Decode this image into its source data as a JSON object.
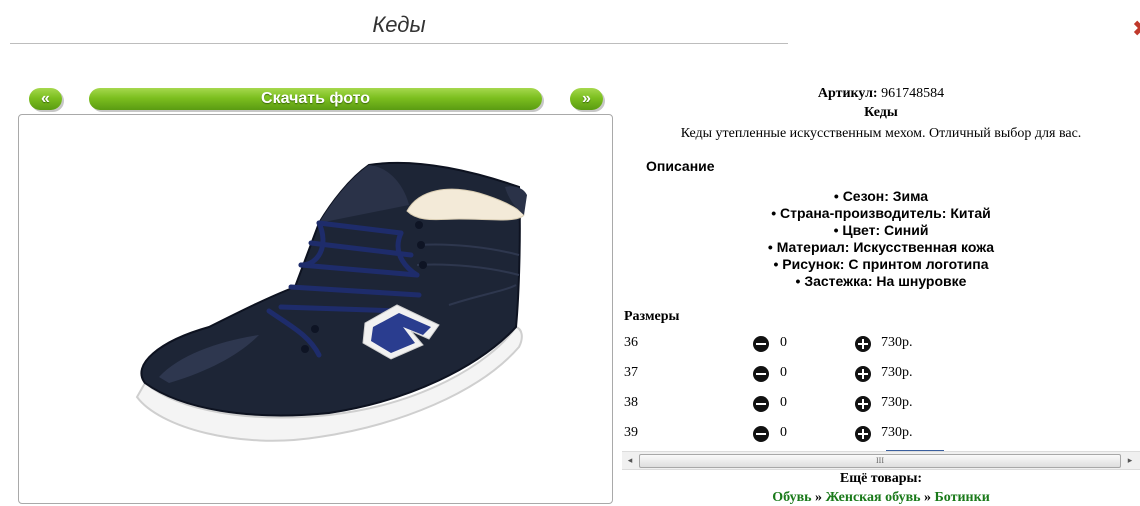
{
  "page": {
    "title": "Кеды"
  },
  "gallery": {
    "prev_label": "«",
    "download_label": "Скачать фото",
    "next_label": "»"
  },
  "product": {
    "article_label": "Артикул:",
    "article_value": "961748584",
    "name": "Кеды",
    "short_description": "Кеды утепленные искусственным мехом. Отличный выбор для вас.",
    "description_heading": "Описание",
    "properties": [
      "Сезон: Зима",
      "Страна-производитель: Китай",
      "Цвет: Синий",
      "Материал: Искусственная кожа",
      "Рисунок: С принтом логотипа",
      "Застежка: На шнуровке"
    ]
  },
  "sizes": {
    "heading": "Размеры",
    "rows": [
      {
        "size": "36",
        "qty": "0",
        "price": "730р."
      },
      {
        "size": "37",
        "qty": "0",
        "price": "730р."
      },
      {
        "size": "38",
        "qty": "0",
        "price": "730р."
      },
      {
        "size": "39",
        "qty": "0",
        "price": "730р."
      }
    ]
  },
  "scrollbar": {
    "left_arrow": "◂",
    "grip": "III",
    "right_arrow": "▸"
  },
  "more": {
    "heading": "Ещё товары:",
    "crumbs": [
      "Обувь",
      "Женская обувь",
      "Ботинки"
    ],
    "separator": "»"
  }
}
